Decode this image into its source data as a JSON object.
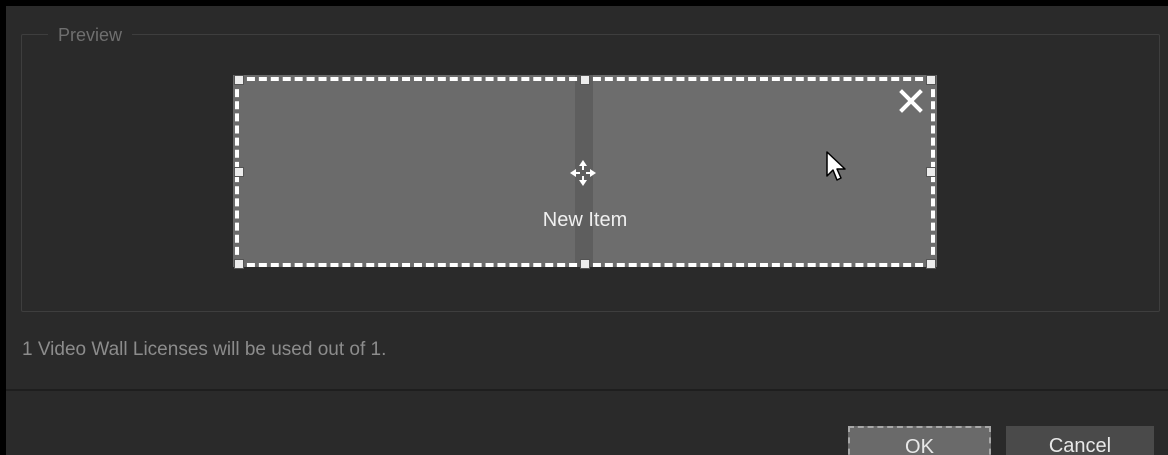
{
  "preview": {
    "legend": "Preview",
    "item": {
      "label": "New Item",
      "icons": {
        "close": "close-icon",
        "move": "move-icon",
        "cursor": "mouse-pointer-icon"
      }
    }
  },
  "license_text": "1 Video Wall Licenses will be used out of 1.",
  "buttons": {
    "ok": "OK",
    "cancel": "Cancel"
  },
  "colors": {
    "background": "#2a2a2a",
    "item_fill": "#6b6b6b",
    "selection": "#ffffff"
  }
}
